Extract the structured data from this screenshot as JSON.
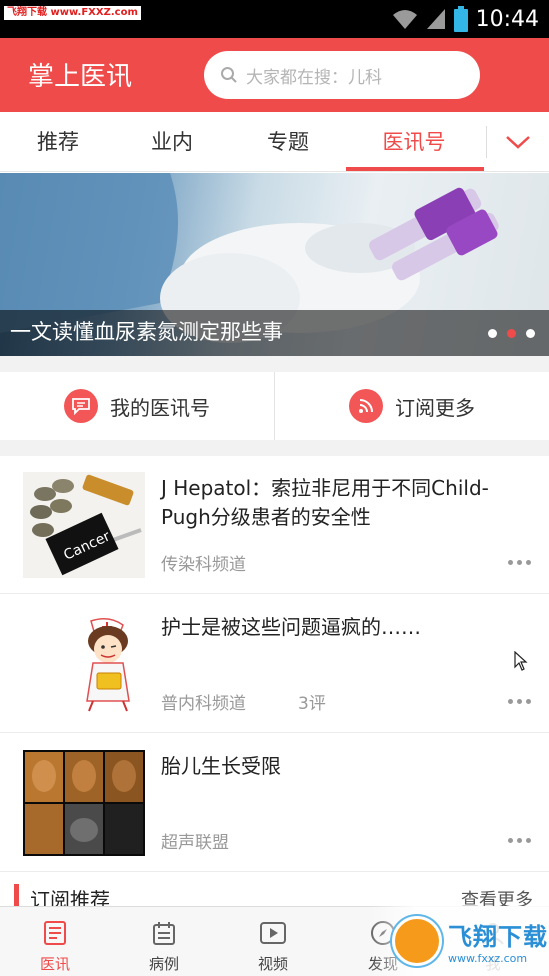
{
  "status_bar": {
    "watermark": "飞翔下载 www.FXXZ.com",
    "time": "10:44"
  },
  "header": {
    "app_title": "掌上医讯",
    "search_placeholder": "大家都在搜：儿科"
  },
  "tabs": [
    {
      "label": "推荐",
      "active": false
    },
    {
      "label": "业内",
      "active": false
    },
    {
      "label": "专题",
      "active": false
    },
    {
      "label": "医讯号",
      "active": true
    }
  ],
  "banner": {
    "caption": "一文读懂血尿素氮测定那些事",
    "slide_count": 3,
    "active_slide": 2
  },
  "actions": {
    "my_channel": "我的医讯号",
    "subscribe_more": "订阅更多"
  },
  "feed": [
    {
      "title": "J Hepatol：索拉非尼用于不同Child-Pugh分级患者的安全性",
      "source": "传染科频道",
      "comments": "",
      "thumb_label": "Cancer"
    },
    {
      "title": "护士是被这些问题逼疯的……",
      "source": "普内科频道",
      "comments": "3评",
      "thumb_label": ""
    },
    {
      "title": "胎儿生长受限",
      "source": "超声联盟",
      "comments": "",
      "thumb_label": ""
    }
  ],
  "section": {
    "title": "订阅推荐",
    "more": "查看更多"
  },
  "bottom_nav": [
    {
      "label": "医讯",
      "icon": "news-icon",
      "active": true
    },
    {
      "label": "病例",
      "icon": "calendar-icon",
      "active": false
    },
    {
      "label": "视频",
      "icon": "video-icon",
      "active": false
    },
    {
      "label": "发现",
      "icon": "compass-icon",
      "active": false
    },
    {
      "label": "我",
      "icon": "person-icon",
      "active": false
    }
  ],
  "bottom_watermark": {
    "name": "飞翔下载",
    "url": "www.fxxz.com"
  },
  "colors": {
    "accent": "#f04b4b",
    "header_bg": "#f04b4b"
  }
}
